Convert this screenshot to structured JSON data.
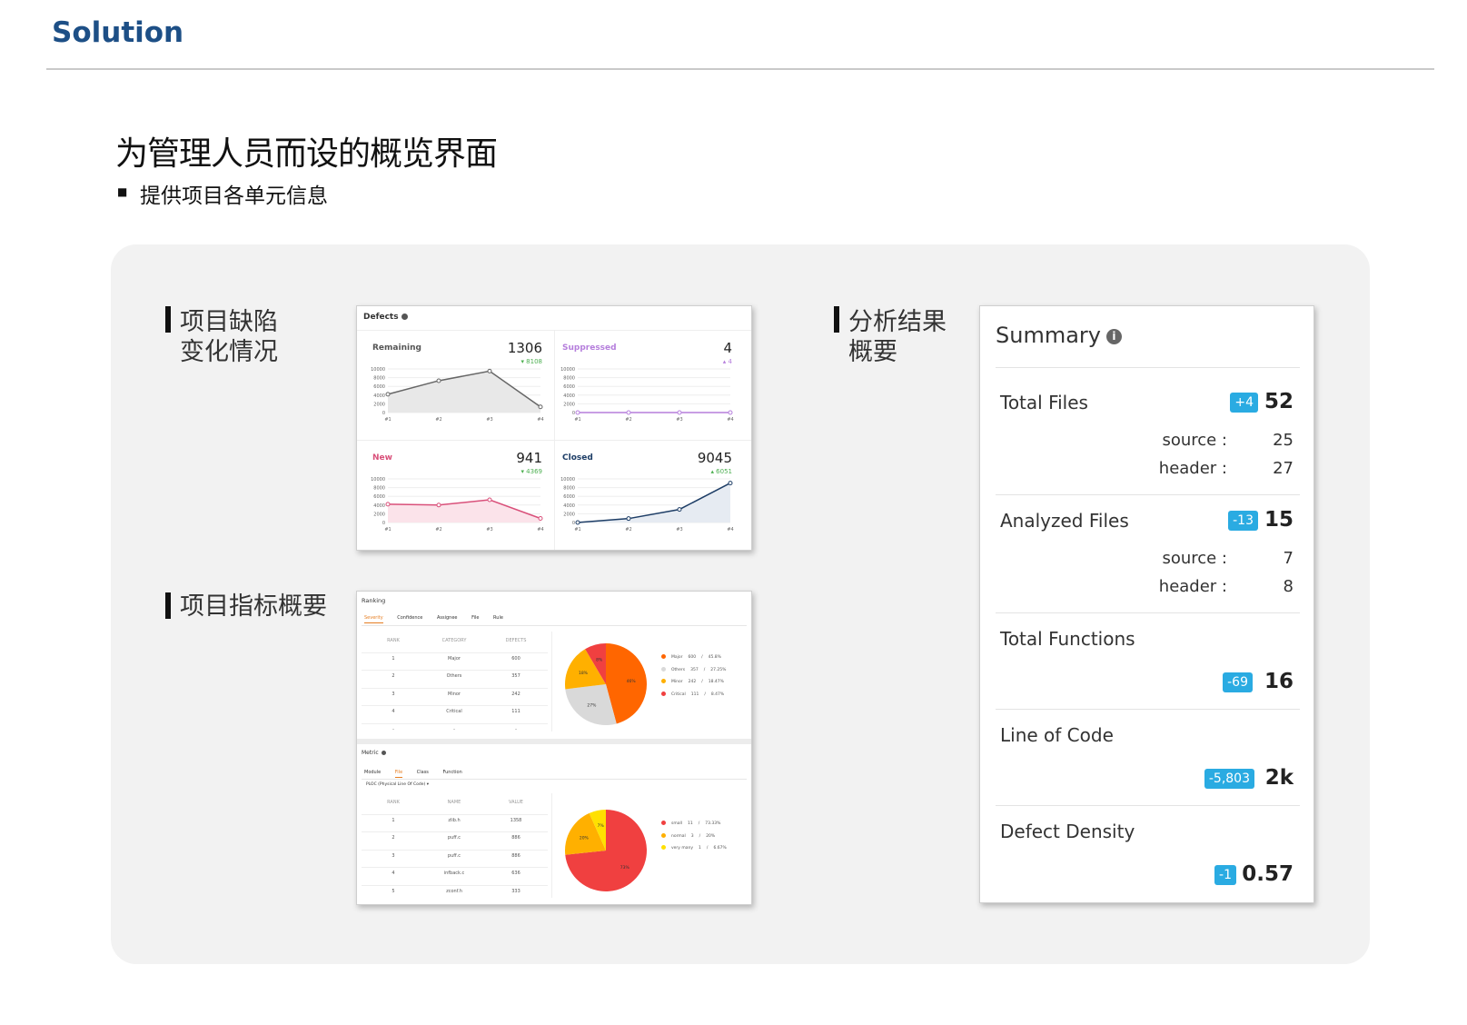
{
  "slide": {
    "title": "Solution",
    "heading": "为管理人员而设的概览界面",
    "bullet": "提供项目各单元信息"
  },
  "sections": {
    "defects_label_1": "项目缺陷",
    "defects_label_2": "变化情况",
    "metrics_label": "项目指标概要",
    "summary_label_1": "分析结果",
    "summary_label_2": "概要"
  },
  "defects": {
    "title": "Defects",
    "quadrants": [
      {
        "name": "Remaining",
        "value": "1306",
        "delta": "▾ 8108",
        "color": "#666666",
        "fill": "#e8e8e8",
        "points": [
          4200,
          7300,
          9500,
          1306
        ]
      },
      {
        "name": "Suppressed",
        "value": "4",
        "delta": "▴ 4",
        "color": "#b57edc",
        "fill": "#f3eafa",
        "points": [
          0,
          0,
          0,
          4
        ]
      },
      {
        "name": "New",
        "value": "941",
        "delta": "▾ 4369",
        "color": "#d9507a",
        "fill": "#fbe3ea",
        "points": [
          4200,
          4000,
          5200,
          941
        ]
      },
      {
        "name": "Closed",
        "value": "9045",
        "delta": "▴ 6051",
        "color": "#1d3d66",
        "fill": "#e6ebf2",
        "points": [
          0,
          900,
          3000,
          9045
        ]
      }
    ],
    "y_ticks": [
      "10000",
      "8000",
      "6000",
      "4000",
      "2000",
      "0"
    ],
    "x_ticks": [
      "#1",
      "#2",
      "#3",
      "#4"
    ]
  },
  "ranking": {
    "title": "Ranking",
    "tabs": [
      "Severity",
      "Confidence",
      "Assignee",
      "File",
      "Rule"
    ],
    "columns": [
      "RANK",
      "CATEGORY",
      "DEFECTS"
    ],
    "rows": [
      [
        "1",
        "Major",
        "600"
      ],
      [
        "2",
        "Others",
        "357"
      ],
      [
        "3",
        "Minor",
        "242"
      ],
      [
        "4",
        "Critical",
        "111"
      ],
      [
        "-",
        "-",
        "-"
      ]
    ],
    "legend": [
      {
        "label": "Major",
        "count": "600",
        "pct": "45.8%",
        "color": "#ff6600"
      },
      {
        "label": "Others",
        "count": "357",
        "pct": "27.25%",
        "color": "#d9d9d9"
      },
      {
        "label": "Minor",
        "count": "242",
        "pct": "18.47%",
        "color": "#ffb000"
      },
      {
        "label": "Critical",
        "count": "111",
        "pct": "8.47%",
        "color": "#f04040"
      }
    ],
    "pie_labels": [
      "46%",
      "27%",
      "18%",
      "8%"
    ]
  },
  "metric": {
    "title": "Metric",
    "tabs": [
      "Module",
      "File",
      "Class",
      "Function"
    ],
    "dropdown": "PLOC (Physical Line Of Code) ▾",
    "columns": [
      "RANK",
      "NAME",
      "VALUE"
    ],
    "rows": [
      [
        "1",
        "zlib.h",
        "1358"
      ],
      [
        "2",
        "puff.c",
        "886"
      ],
      [
        "3",
        "puff.c",
        "886"
      ],
      [
        "4",
        "infback.c",
        "636"
      ],
      [
        "5",
        "zconf.h",
        "333"
      ]
    ],
    "legend": [
      {
        "label": "small",
        "count": "11",
        "pct": "73.33%",
        "color": "#f04040"
      },
      {
        "label": "normal",
        "count": "3",
        "pct": "20%",
        "color": "#ffb000"
      },
      {
        "label": "very many",
        "count": "1",
        "pct": "6.67%",
        "color": "#ffe000"
      }
    ],
    "pie_labels": [
      "73%",
      "20%",
      "7%"
    ]
  },
  "summary": {
    "title": "Summary",
    "total_files": {
      "label": "Total Files",
      "badge": "+4",
      "value": "52"
    },
    "total_files_source": {
      "label": "source :",
      "value": "25"
    },
    "total_files_header": {
      "label": "header :",
      "value": "27"
    },
    "analyzed_files": {
      "label": "Analyzed Files",
      "badge": "-13",
      "value": "15"
    },
    "analyzed_files_source": {
      "label": "source :",
      "value": "7"
    },
    "analyzed_files_header": {
      "label": "header :",
      "value": "8"
    },
    "total_functions": {
      "label": "Total Functions",
      "badge": "-69",
      "value": "16"
    },
    "line_of_code": {
      "label": "Line of Code",
      "badge": "-5,803",
      "value": "2k"
    },
    "defect_density": {
      "label": "Defect Density",
      "badge": "-1",
      "value": "0.57"
    }
  }
}
